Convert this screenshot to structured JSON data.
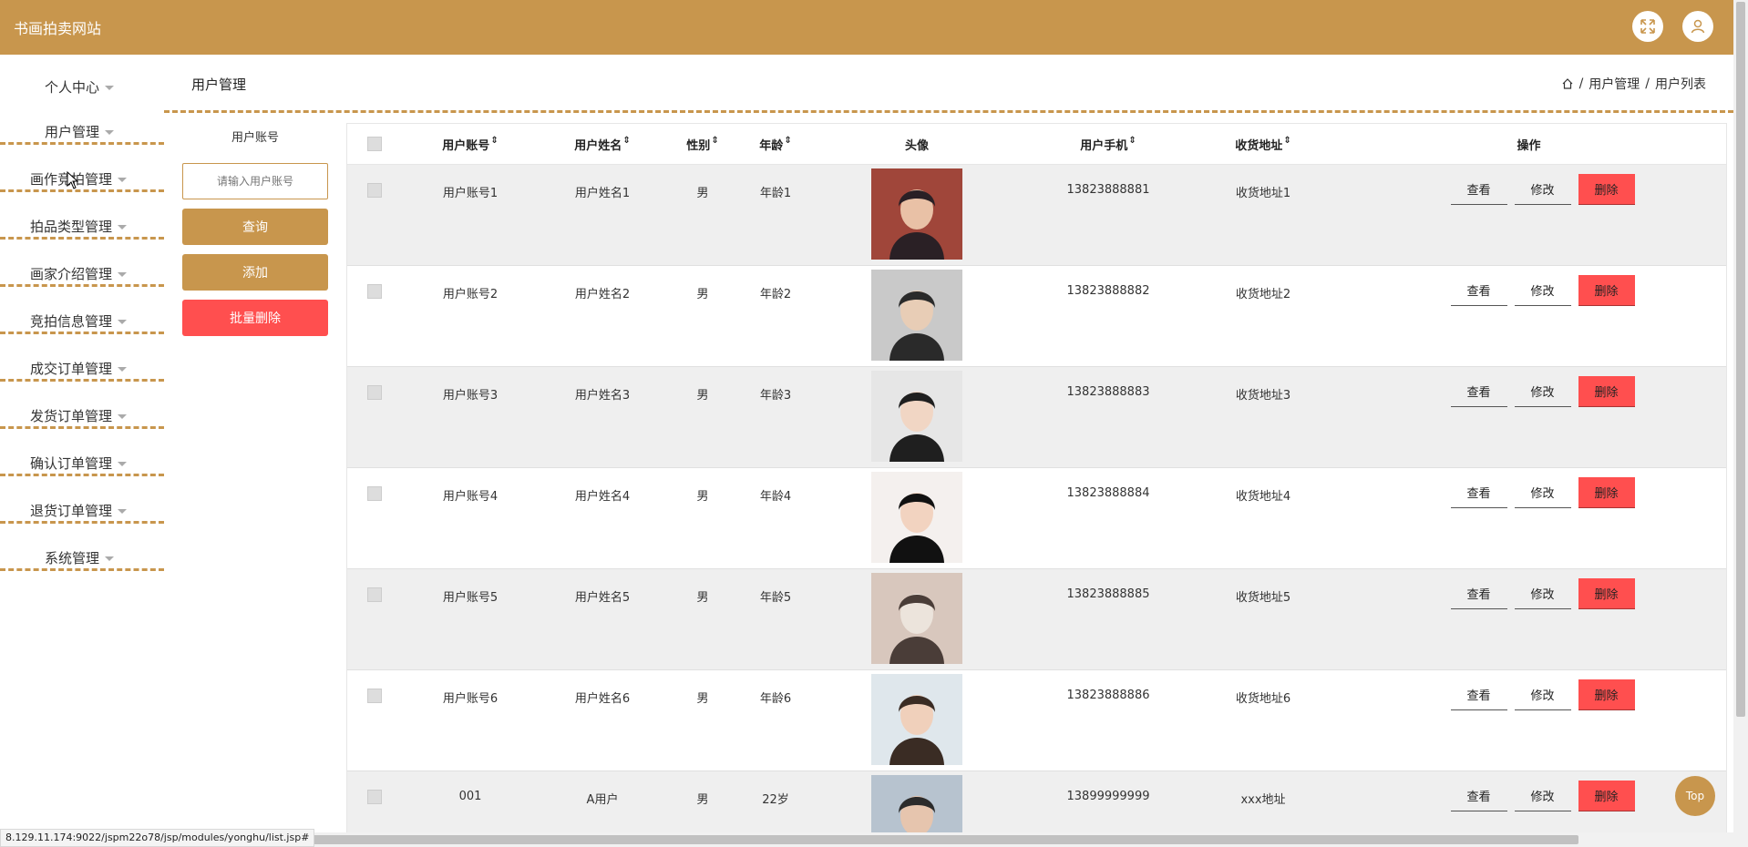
{
  "app": {
    "title": "书画拍卖网站"
  },
  "colors": {
    "brand": "#c8964d",
    "danger": "#ff4f4f",
    "row_alt": "#efefef"
  },
  "header": {
    "fullscreen_icon": "fullscreen-icon",
    "user_icon": "user-icon"
  },
  "sidebar": {
    "items": [
      {
        "label": "个人中心"
      },
      {
        "label": "用户管理"
      },
      {
        "label": "画作竞拍管理"
      },
      {
        "label": "拍品类型管理"
      },
      {
        "label": "画家介绍管理"
      },
      {
        "label": "竞拍信息管理"
      },
      {
        "label": "成交订单管理"
      },
      {
        "label": "发货订单管理"
      },
      {
        "label": "确认订单管理"
      },
      {
        "label": "退货订单管理"
      },
      {
        "label": "系统管理"
      }
    ]
  },
  "page": {
    "title": "用户管理",
    "breadcrumb": [
      "用户管理",
      "/",
      "用户列表"
    ]
  },
  "search": {
    "label": "用户账号",
    "placeholder": "请输入用户账号",
    "query_label": "查询",
    "add_label": "添加",
    "batch_delete_label": "批量删除"
  },
  "table": {
    "headers": {
      "account": "用户账号",
      "name": "用户姓名",
      "sex": "性别",
      "age": "年龄",
      "avatar": "头像",
      "phone": "用户手机",
      "address": "收货地址",
      "ops": "操作"
    },
    "sort_icon": "⇕",
    "rows": [
      {
        "account": "用户账号1",
        "name": "用户姓名1",
        "sex": "男",
        "age": "年龄1",
        "phone": "13823888881",
        "address": "收货地址1"
      },
      {
        "account": "用户账号2",
        "name": "用户姓名2",
        "sex": "男",
        "age": "年龄2",
        "phone": "13823888882",
        "address": "收货地址2"
      },
      {
        "account": "用户账号3",
        "name": "用户姓名3",
        "sex": "男",
        "age": "年龄3",
        "phone": "13823888883",
        "address": "收货地址3"
      },
      {
        "account": "用户账号4",
        "name": "用户姓名4",
        "sex": "男",
        "age": "年龄4",
        "phone": "13823888884",
        "address": "收货地址4"
      },
      {
        "account": "用户账号5",
        "name": "用户姓名5",
        "sex": "男",
        "age": "年龄5",
        "phone": "13823888885",
        "address": "收货地址5"
      },
      {
        "account": "用户账号6",
        "name": "用户姓名6",
        "sex": "男",
        "age": "年龄6",
        "phone": "13823888886",
        "address": "收货地址6"
      },
      {
        "account": "001",
        "name": "A用户",
        "sex": "男",
        "age": "22岁",
        "phone": "13899999999",
        "address": "xxx地址"
      }
    ],
    "ops": {
      "view": "查看",
      "edit": "修改",
      "delete": "删除"
    }
  },
  "top_button": "Top",
  "status_url": "8.129.11.174:9022/jspm22o78/jsp/modules/yonghu/list.jsp#"
}
